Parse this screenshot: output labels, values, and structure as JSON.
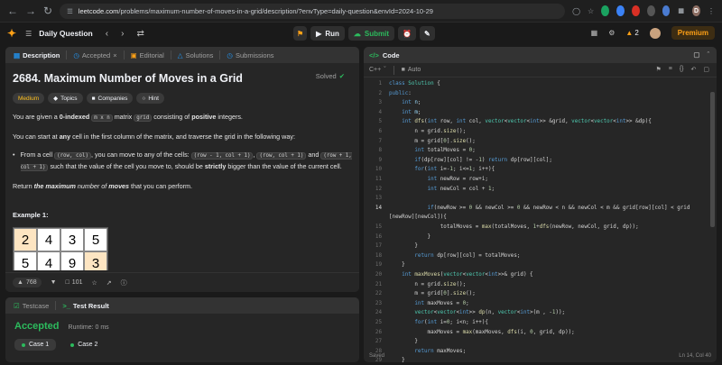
{
  "browser": {
    "url_domain": "leetcode.com",
    "url_path": "/problems/maximum-number-of-moves-in-a-grid/description/?envType=daily-question&envId=2024-10-29",
    "profile_initial": "D"
  },
  "navbar": {
    "daily_question": "Daily Question",
    "run_label": "Run",
    "submit_label": "Submit",
    "streak": "2",
    "premium_label": "Premium"
  },
  "desc_tabs": [
    "Description",
    "Accepted",
    "Editorial",
    "Solutions",
    "Submissions"
  ],
  "problem": {
    "title": "2684. Maximum Number of Moves in a Grid",
    "solved_label": "Solved",
    "difficulty": "Medium",
    "pill_topics": "Topics",
    "pill_companies": "Companies",
    "pill_hint": "Hint",
    "p1_a": "You are given a ",
    "p1_b": "0-indexed",
    "p1_c": "m x n",
    "p1_d": " matrix ",
    "p1_e": "grid",
    "p1_f": " consisting of ",
    "p1_g": "positive",
    "p1_h": " integers.",
    "p2_a": "You can start at ",
    "p2_b": "any",
    "p2_c": " cell in the first column of the matrix, and traverse the grid in the following way:",
    "b_a": "From a cell ",
    "b_c1": "(row, col)",
    "b_b": ", you can move to any of the cells: ",
    "b_c2": "(row - 1, col + 1)",
    "b_comma": ", ",
    "b_c3": "(row, col + 1)",
    "b_and": " and ",
    "b_c4": "(row + 1, col + 1)",
    "b_d": " such that the value of the cell you move to, should be ",
    "b_e": "strictly",
    "b_f": " bigger than the value of the current cell.",
    "p3_a": "Return ",
    "p3_b": "the ",
    "p3_c": "maximum",
    "p3_d": " number of ",
    "p3_e": "moves",
    "p3_f": " that you can perform.",
    "example_title": "Example 1:",
    "grid_rows": [
      [
        "2",
        "4",
        "3",
        "5"
      ],
      [
        "5",
        "4",
        "9",
        "3"
      ]
    ],
    "likes": "768",
    "comments": "101"
  },
  "test": {
    "tab_testcase": "Testcase",
    "tab_result": "Test Result",
    "status": "Accepted",
    "runtime": "Runtime: 0 ms",
    "case1": "Case 1",
    "case2": "Case 2"
  },
  "code_panel": {
    "tab_label": "Code",
    "language": "C++",
    "mode": "Auto",
    "saved": "Saved",
    "cursor": "Ln 14, Col 40"
  },
  "colors": {
    "accent": "#ffa116",
    "accepted": "#2cbb5d",
    "submit": "#2cbb5d",
    "medium": "#ffc01e"
  },
  "icons": [
    "leetcode-logo-icon",
    "chevron-left-icon",
    "chevron-right-icon",
    "shuffle-icon",
    "play-icon",
    "cloud-upload-icon",
    "gear-icon",
    "grid-icon",
    "fire-icon",
    "description-icon",
    "flask-icon",
    "code-icon",
    "thumb-up-icon",
    "comment-icon",
    "star-icon",
    "share-icon",
    "help-icon"
  ]
}
